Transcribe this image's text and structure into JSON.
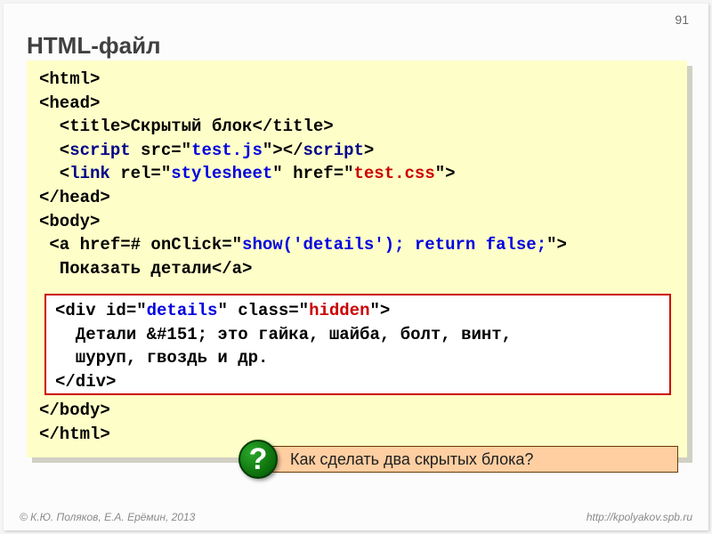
{
  "page_number": "91",
  "title": "HTML-файл",
  "code": {
    "l1": "<html>",
    "l2": "<head>",
    "l3_a": "  <title>",
    "l3_b": "Скрытый блок",
    "l3_c": "</title>",
    "l4_a": "  <",
    "l4_script": "script",
    "l4_b": " src=\"",
    "l4_src": "test.js",
    "l4_c": "\"></",
    "l4_d": ">",
    "l5_a": "  <",
    "l5_link": "link",
    "l5_b": " rel=\"",
    "l5_rel": "stylesheet",
    "l5_c": "\" href=\"",
    "l5_href": "test.css",
    "l5_d": "\">",
    "l6": "</head>",
    "l7": "<body>",
    "l8_a": " <a href=# onClick=\"",
    "l8_js": "show('details'); return false;",
    "l8_b": "\">",
    "l9": "  Показать детали</a>",
    "l10": "</body>",
    "l11": "</html>"
  },
  "inner": {
    "l1_a": "<div id=\"",
    "l1_id": "details",
    "l1_b": "\" class=\"",
    "l1_cls": "hidden",
    "l1_c": "\">",
    "l2": "  Детали &#151; это гайка, шайба, болт, винт,",
    "l3": "  шуруп, гвоздь и др.",
    "l4": "</div>"
  },
  "question": "Как сделать два скрытых блока?",
  "qmark": "?",
  "footer_left": "© К.Ю. Поляков, Е.А. Ерёмин, 2013",
  "footer_right": "http://kpolyakov.spb.ru"
}
